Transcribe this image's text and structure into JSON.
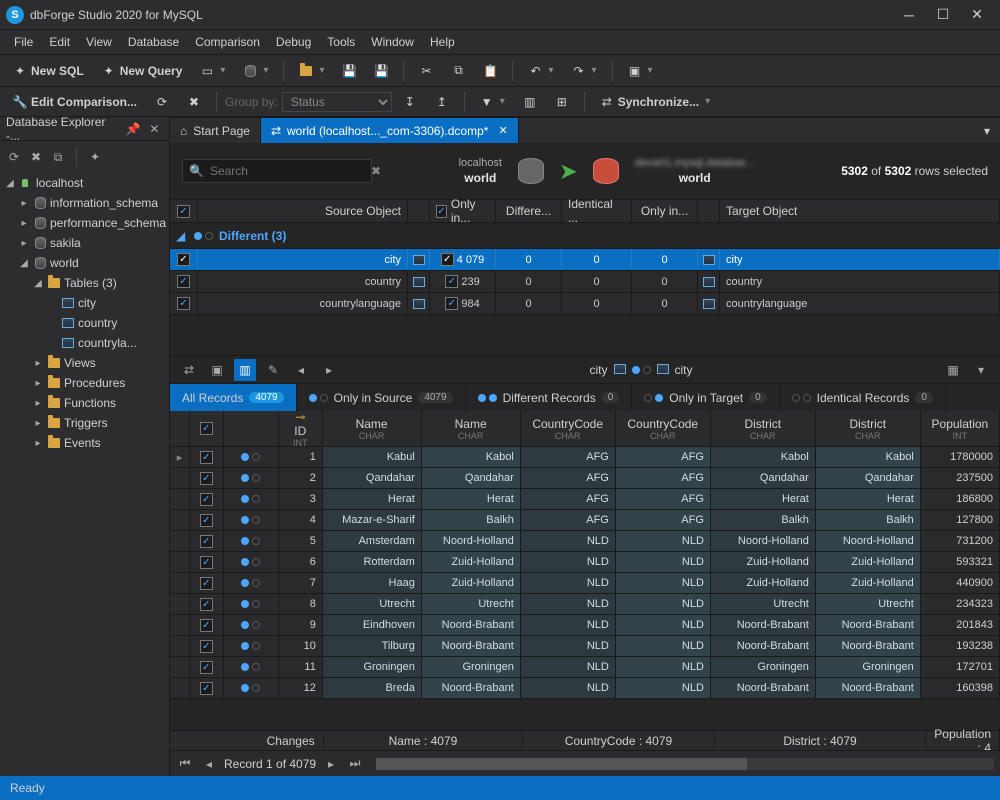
{
  "app": {
    "title": "dbForge Studio 2020 for MySQL"
  },
  "menu": [
    "File",
    "Edit",
    "View",
    "Database",
    "Comparison",
    "Debug",
    "Tools",
    "Window",
    "Help"
  ],
  "toolbar1": {
    "newSql": "New SQL",
    "newQuery": "New Query"
  },
  "toolbar2": {
    "editComparison": "Edit Comparison...",
    "groupBy": "Group by:",
    "groupByValue": "Status",
    "synchronize": "Synchronize..."
  },
  "tabs": {
    "start": "Start Page",
    "doc": "world (localhost..._com-3306).dcomp*"
  },
  "explorer": {
    "title": "Database Explorer -...",
    "root": "localhost",
    "sysdbs": [
      "information_schema",
      "performance_schema",
      "sakila"
    ],
    "maindb": "world",
    "tablesLabel": "Tables (3)",
    "tables": [
      "city",
      "country",
      "countryla..."
    ],
    "folders": [
      "Views",
      "Procedures",
      "Functions",
      "Triggers",
      "Events"
    ]
  },
  "compare": {
    "search_placeholder": "Search",
    "source": {
      "server": "localhost",
      "db": "world"
    },
    "target": {
      "server": "devart1.mysql.databas...",
      "db": "world"
    },
    "stat_prefix": "5302",
    "stat_mid": " of ",
    "stat_bold": "5302",
    "stat_suffix": " rows selected",
    "head": {
      "srcObj": "Source Object",
      "onlyIn": "Only in...",
      "diff": "Differe...",
      "ident": "Identical ...",
      "onlyIn2": "Only in...",
      "tgtObj": "Target Object"
    },
    "group": "Different (3)",
    "rows": [
      {
        "name": "city",
        "diff": "4 079",
        "only1": "0",
        "ident": "0",
        "only2": "0",
        "tgt": "city",
        "sel": true
      },
      {
        "name": "country",
        "diff": "239",
        "only1": "0",
        "ident": "0",
        "only2": "0",
        "tgt": "country",
        "sel": false
      },
      {
        "name": "countrylanguage",
        "diff": "984",
        "only1": "0",
        "ident": "0",
        "only2": "0",
        "tgt": "countrylanguage",
        "sel": false
      }
    ],
    "mirror": {
      "left": "city",
      "right": "city"
    }
  },
  "filters": {
    "all": {
      "label": "All Records",
      "count": "4079"
    },
    "onlySrc": {
      "label": "Only in Source",
      "count": "4079"
    },
    "diff": {
      "label": "Different Records",
      "count": "0"
    },
    "onlyTgt": {
      "label": "Only in Target",
      "count": "0"
    },
    "ident": {
      "label": "Identical Records",
      "count": "0"
    }
  },
  "gridHead": {
    "id": "ID",
    "idT": "INT",
    "name": "Name",
    "nameT": "CHAR",
    "cc": "CountryCode",
    "ccT": "CHAR",
    "dist": "District",
    "distT": "CHAR",
    "pop": "Population",
    "popT": "INT"
  },
  "rows": [
    {
      "id": "1",
      "n1": "Kabul",
      "c1": "AFG",
      "n2": "Kabol",
      "c2": "AFG",
      "d1": "Kabol",
      "d2": "Kabol",
      "p": "1780000"
    },
    {
      "id": "2",
      "n1": "Qandahar",
      "c1": "AFG",
      "n2": "Qandahar",
      "c2": "AFG",
      "d1": "Qandahar",
      "d2": "Qandahar",
      "p": "237500"
    },
    {
      "id": "3",
      "n1": "Herat",
      "c1": "AFG",
      "n2": "Herat",
      "c2": "AFG",
      "d1": "Herat",
      "d2": "Herat",
      "p": "186800"
    },
    {
      "id": "4",
      "n1": "Mazar-e-Sharif",
      "c1": "AFG",
      "n2": "Balkh",
      "c2": "AFG",
      "d1": "Balkh",
      "d2": "Balkh",
      "p": "127800"
    },
    {
      "id": "5",
      "n1": "Amsterdam",
      "c1": "NLD",
      "n2": "Noord-Holland",
      "c2": "NLD",
      "d1": "Noord-Holland",
      "d2": "Noord-Holland",
      "p": "731200"
    },
    {
      "id": "6",
      "n1": "Rotterdam",
      "c1": "NLD",
      "n2": "Zuid-Holland",
      "c2": "NLD",
      "d1": "Zuid-Holland",
      "d2": "Zuid-Holland",
      "p": "593321"
    },
    {
      "id": "7",
      "n1": "Haag",
      "c1": "NLD",
      "n2": "Zuid-Holland",
      "c2": "NLD",
      "d1": "Zuid-Holland",
      "d2": "Zuid-Holland",
      "p": "440900"
    },
    {
      "id": "8",
      "n1": "Utrecht",
      "c1": "NLD",
      "n2": "Utrecht",
      "c2": "NLD",
      "d1": "Utrecht",
      "d2": "Utrecht",
      "p": "234323"
    },
    {
      "id": "9",
      "n1": "Eindhoven",
      "c1": "NLD",
      "n2": "Noord-Brabant",
      "c2": "NLD",
      "d1": "Noord-Brabant",
      "d2": "Noord-Brabant",
      "p": "201843"
    },
    {
      "id": "10",
      "n1": "Tilburg",
      "c1": "NLD",
      "n2": "Noord-Brabant",
      "c2": "NLD",
      "d1": "Noord-Brabant",
      "d2": "Noord-Brabant",
      "p": "193238"
    },
    {
      "id": "11",
      "n1": "Groningen",
      "c1": "NLD",
      "n2": "Groningen",
      "c2": "NLD",
      "d1": "Groningen",
      "d2": "Groningen",
      "p": "172701"
    },
    {
      "id": "12",
      "n1": "Breda",
      "c1": "NLD",
      "n2": "Noord-Brabant",
      "c2": "NLD",
      "d1": "Noord-Brabant",
      "d2": "Noord-Brabant",
      "p": "160398"
    }
  ],
  "summary": {
    "changes": "Changes",
    "name": "Name : 4079",
    "cc": "CountryCode : 4079",
    "dist": "District : 4079",
    "pop": "Population : 4"
  },
  "nav": {
    "record": "Record 1 of 4079"
  },
  "status": "Ready"
}
